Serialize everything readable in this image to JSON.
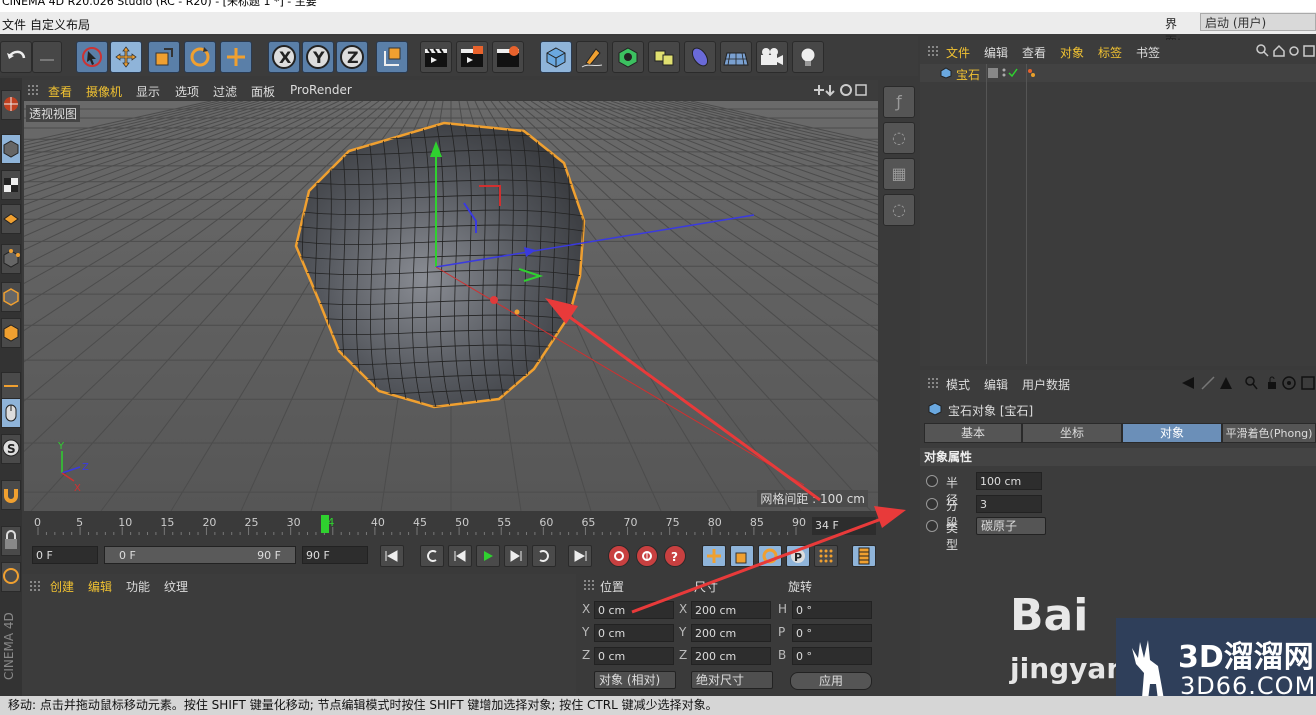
{
  "window": {
    "title": "CINEMA 4D R20.026 Studio (RC - R20) - [未标题 1 *] - 主要"
  },
  "menu": {
    "file": "文件",
    "custom_layout": "自定义布局",
    "layout_label": "界面:",
    "layout_value": "启动 (用户)"
  },
  "viewport_menu": [
    "查看",
    "摄像机",
    "显示",
    "选项",
    "过滤",
    "面板",
    "ProRender"
  ],
  "viewport": {
    "label": "透视视图",
    "grid_spacing": "网格间距 : 100 cm"
  },
  "timeline": {
    "ticks": [
      "0",
      "5",
      "10",
      "15",
      "20",
      "25",
      "30",
      "34",
      "40",
      "45",
      "50",
      "55",
      "60",
      "65",
      "70",
      "75",
      "80",
      "85",
      "90"
    ],
    "current_frame": "34 F",
    "start_field": "0 F",
    "slider_start": "0 F",
    "slider_end": "90 F",
    "end_field": "90 F"
  },
  "material_menu": [
    "创建",
    "编辑",
    "功能",
    "纹理"
  ],
  "cinema_logo": "CINEMA 4D",
  "coords": {
    "headers": {
      "position": "位置",
      "size": "尺寸",
      "rotation": "旋转"
    },
    "rows": [
      {
        "axis": "X",
        "pos": "0 cm",
        "size_axis": "X",
        "size": "200 cm",
        "rot_axis": "H",
        "rot": "0 °"
      },
      {
        "axis": "Y",
        "pos": "0 cm",
        "size_axis": "Y",
        "size": "200 cm",
        "rot_axis": "P",
        "rot": "0 °"
      },
      {
        "axis": "Z",
        "pos": "0 cm",
        "size_axis": "Z",
        "size": "200 cm",
        "rot_axis": "B",
        "rot": "0 °"
      }
    ],
    "mode_object": "对象 (相对)",
    "mode_size": "绝对尺寸",
    "apply": "应用"
  },
  "object_manager": {
    "menu": [
      "文件",
      "编辑",
      "查看",
      "对象",
      "标签",
      "书签"
    ],
    "object_name": "宝石"
  },
  "attribute_manager": {
    "menu": [
      "模式",
      "编辑",
      "用户数据"
    ],
    "title": "宝石对象 [宝石]",
    "tabs": [
      "基本",
      "坐标",
      "对象",
      "平滑着色(Phong)"
    ],
    "active_tab": "对象",
    "section": "对象属性",
    "props": [
      {
        "label": "半径",
        "value": "100 cm"
      },
      {
        "label": "分段",
        "value": "3"
      },
      {
        "label": "类型",
        "value": "碳原子"
      }
    ]
  },
  "status_bar": "移动: 点击并拖动鼠标移动元素。按住 SHIFT 键量化移动; 节点编辑模式时按住 SHIFT 键增加选择对象; 按住 CTRL 键减少选择对象。",
  "watermark": {
    "baidu": "Bai",
    "jingyan": "jingyan",
    "brand_cn": "3D溜溜网",
    "brand_en": "3D66.COM"
  },
  "colors": {
    "accent": "#f1c232",
    "selection": "#f0a030",
    "annotation_arrow": "#e83a3a"
  }
}
